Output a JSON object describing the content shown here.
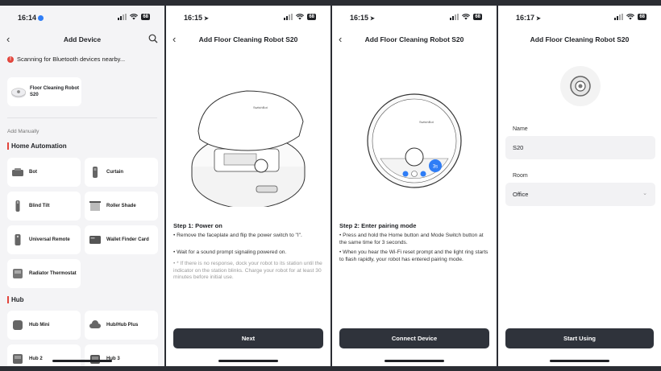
{
  "screens": [
    {
      "time": "16:14",
      "battery": "68",
      "title": "Add Device",
      "scan_text": "Scanning for Bluetooth devices nearby...",
      "found_device": "Floor Cleaning Robot S20",
      "add_manually": "Add Manually",
      "sections": [
        {
          "title": "Home Automation",
          "items": [
            "Bot",
            "Curtain",
            "Blind Tilt",
            "Roller Shade",
            "Universal Remote",
            "Wallet Finder Card",
            "Radiator Thermostat"
          ]
        },
        {
          "title": "Hub",
          "items": [
            "Hub Mini",
            "Hub/Hub Plus",
            "Hub 2",
            "Hub 3"
          ]
        }
      ]
    },
    {
      "time": "16:15",
      "battery": "68",
      "title": "Add Floor Cleaning Robot S20",
      "brand": "SwitchBot",
      "step_title": "Step 1: Power on",
      "bullets": [
        "• Remove the faceplate and flip the power switch to \"I\".",
        "• Wait for a sound prompt signaling powered on."
      ],
      "note": "• * If there is no response, dock your robot to its station until the indicator on the station blinks. Charge your robot for at least 30 minutes before initial use.",
      "button": "Next"
    },
    {
      "time": "16:15",
      "battery": "68",
      "title": "Add Floor Cleaning Robot S20",
      "brand": "SwitchBot",
      "press_badge": "3s",
      "step_title": "Step 2: Enter pairing mode",
      "bullets": [
        "• Press and hold the Home button and Mode Switch button at the same time for 3 seconds.",
        "• When you hear the Wi-Fi reset prompt and the light ring starts to flash rapidly, your robot has entered pairing mode."
      ],
      "button": "Connect Device"
    },
    {
      "time": "16:17",
      "battery": "68",
      "title": "Add Floor Cleaning Robot S20",
      "name_label": "Name",
      "name_value": "S20",
      "room_label": "Room",
      "room_value": "Office",
      "button": "Start Using"
    }
  ],
  "colors": {
    "accent": "#e2453c",
    "button": "#2f333b",
    "highlight": "#2f7df6"
  }
}
